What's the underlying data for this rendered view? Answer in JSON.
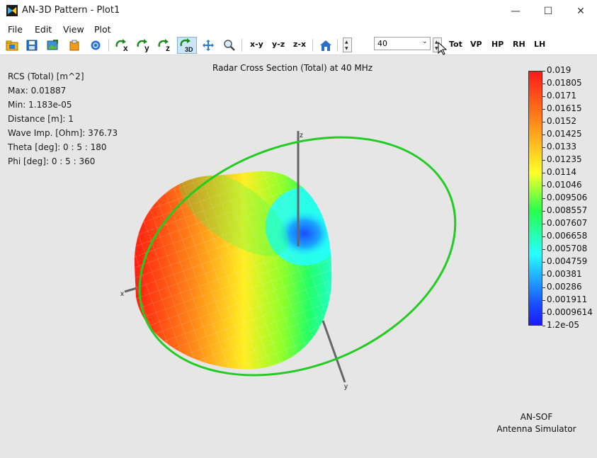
{
  "window": {
    "title": "AN-3D Pattern - Plot1",
    "controls": {
      "minimize": "—",
      "maximize": "☐",
      "close": "✕"
    }
  },
  "menu": [
    "File",
    "Edit",
    "View",
    "Plot"
  ],
  "toolbar": {
    "icons": [
      "open-icon",
      "save-icon",
      "export-image-icon",
      "clipboard-icon",
      "settings-gear-icon",
      "rotate-x-icon",
      "rotate-y-icon",
      "rotate-z-icon",
      "rotate-3d-icon",
      "move-icon",
      "zoom-icon"
    ],
    "rotate_labels": {
      "x": "x",
      "y": "y",
      "z": "z",
      "3d": "3D"
    },
    "plane_buttons": [
      "x-y",
      "y-z",
      "z-x"
    ],
    "home_icon": "home-icon",
    "frequency_value": "40",
    "polarization_buttons": [
      "Tot",
      "VP",
      "HP",
      "RH",
      "LH"
    ]
  },
  "info": {
    "lines": [
      "RCS (Total) [m^2]",
      "Max: 0.01887",
      "Min: 1.183e-05",
      "Distance [m]: 1",
      "Wave Imp. [Ohm]: 376.73",
      "Theta [deg]: 0 : 5 : 180",
      "Phi [deg]: 0 : 5 : 360"
    ]
  },
  "plot": {
    "title": "Radar Cross Section (Total) at 40 MHz",
    "axes": {
      "x": "x",
      "y": "y",
      "z": "z"
    },
    "pattern_colors": {
      "max": "#ff1a1a",
      "mid": "#ffff26",
      "low": "#26ffff",
      "min": "#1a4dff"
    },
    "ring_color": "#22cc22"
  },
  "colorbar": {
    "labels": [
      "0.019",
      "0.01805",
      "0.0171",
      "0.01615",
      "0.0152",
      "0.01425",
      "0.0133",
      "0.01235",
      "0.0114",
      "0.01046",
      "0.009506",
      "0.008557",
      "0.007607",
      "0.006658",
      "0.005708",
      "0.004759",
      "0.00381",
      "0.00286",
      "0.001911",
      "0.0009614",
      "1.2e-05"
    ]
  },
  "brand": {
    "line1": "AN-SOF",
    "line2": "Antenna Simulator"
  }
}
